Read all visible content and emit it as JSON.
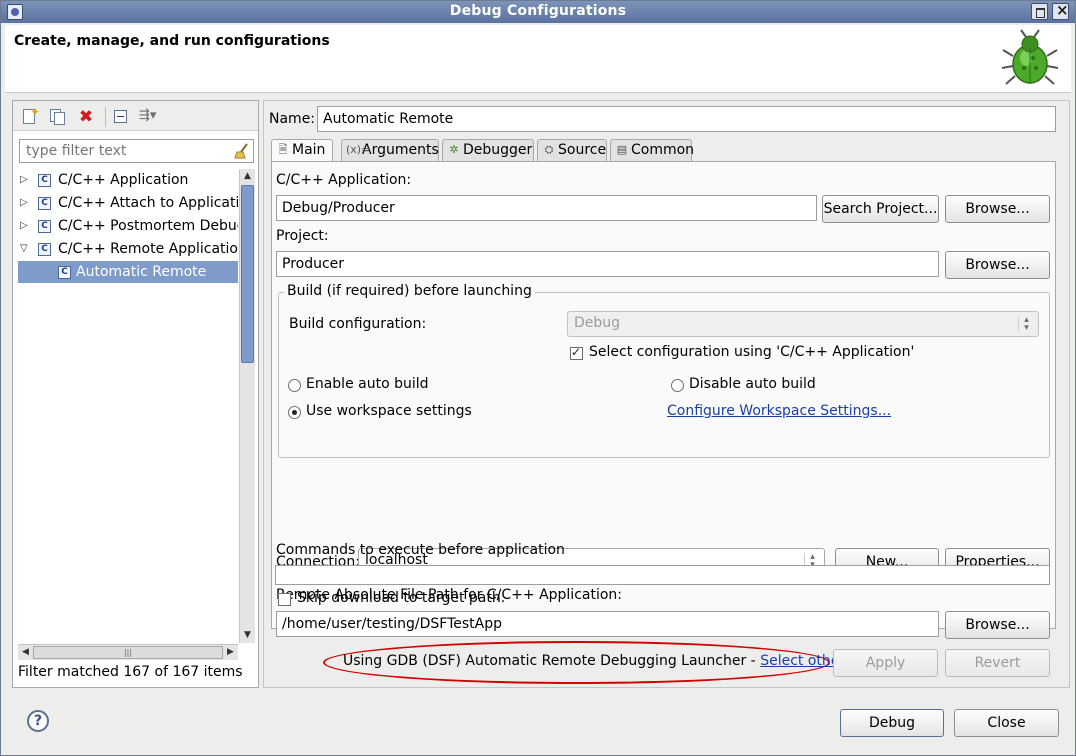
{
  "window": {
    "title": "Debug Configurations",
    "heading": "Create, manage, and run configurations"
  },
  "left": {
    "filter_placeholder": "type filter text",
    "tree": [
      {
        "label": "C/C++ Application",
        "expanded": false
      },
      {
        "label": "C/C++ Attach to Application",
        "expanded": false
      },
      {
        "label": "C/C++ Postmortem Debugger",
        "expanded": false
      },
      {
        "label": "C/C++ Remote Application",
        "expanded": true
      },
      {
        "label": "Automatic Remote",
        "child": true,
        "selected": true
      }
    ],
    "status": "Filter matched 167 of 167 items"
  },
  "form": {
    "name_label": "Name:",
    "name_value": "Automatic Remote",
    "tabs": [
      {
        "label": "Main",
        "icon": "page-icon",
        "active": true
      },
      {
        "label": "Arguments",
        "icon": "variable-icon"
      },
      {
        "label": "Debugger",
        "icon": "bug-gear-icon"
      },
      {
        "label": "Source",
        "icon": "source-icon"
      },
      {
        "label": "Common",
        "icon": "common-icon"
      }
    ],
    "app_label": "C/C++ Application:",
    "app_value": "Debug/Producer",
    "search_project": "Search Project...",
    "browse": "Browse...",
    "project_label": "Project:",
    "project_value": "Producer",
    "build_group": "Build (if required) before launching",
    "build_config_label": "Build configuration:",
    "build_config_value": "Debug",
    "select_config_label": "Select configuration using 'C/C++ Application'",
    "select_config_checked": true,
    "enable_auto_build": "Enable auto build",
    "disable_auto_build": "Disable auto build",
    "use_workspace": "Use workspace settings",
    "configure_workspace": "Configure Workspace Settings...",
    "connection_label": "Connection:",
    "connection_value": "localhost",
    "new_button": "New...",
    "properties_button": "Properties...",
    "remote_path_label": "Remote Absolute File Path for C/C++ Application:",
    "remote_path_value": "/home/user/testing/DSFTestApp",
    "commands_label": "Commands to execute before application",
    "commands_value": "",
    "skip_download": "Skip download to target path.",
    "skip_download_checked": false
  },
  "launcher": {
    "text": "Using GDB (DSF) Automatic Remote Debugging Launcher - ",
    "link": "Select other..."
  },
  "buttons": {
    "apply": "Apply",
    "revert": "Revert",
    "debug": "Debug",
    "close": "Close"
  },
  "colors": {
    "selection": "#7f9bca",
    "link": "#1a3fa8",
    "annotation_red": "#d40000"
  }
}
